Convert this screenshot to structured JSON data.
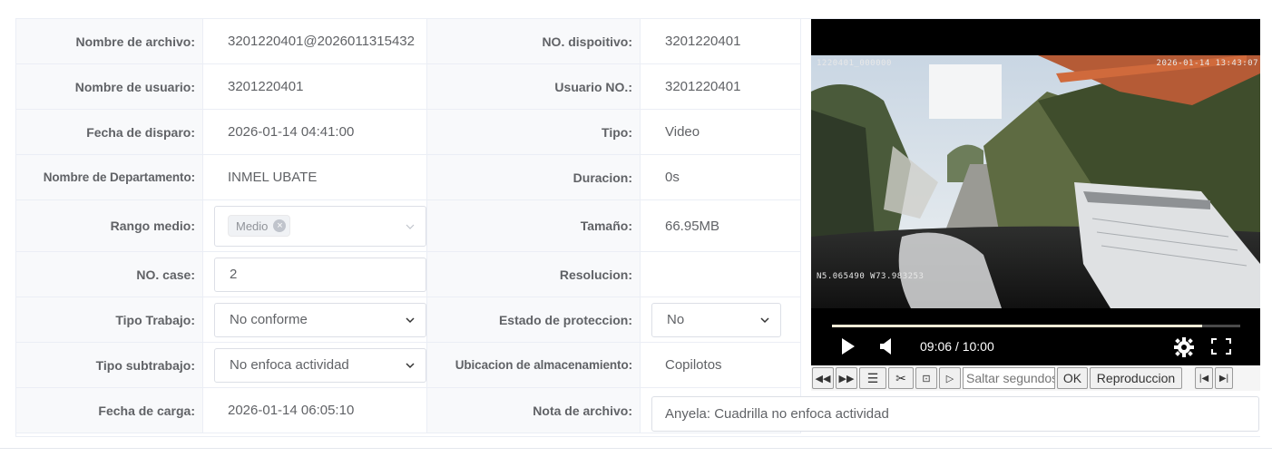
{
  "rows": [
    {
      "l1": "Nombre de archivo:",
      "v1": "3201220401@2026011315432",
      "l2": "NO. dispoitivo:",
      "v2": "3201220401"
    },
    {
      "l1": "Nombre de usuario:",
      "v1": "3201220401",
      "l2": "Usuario NO.:",
      "v2": "3201220401"
    },
    {
      "l1": "Fecha de disparo:",
      "v1": "2026-01-14 04:41:00",
      "l2": "Tipo:",
      "v2": "Video"
    },
    {
      "l1": "Nombre de Departamento:",
      "v1": "INMEL UBATE",
      "l2": "Duracion:",
      "v2": "0s"
    },
    {
      "l1": "Rango medio:",
      "v1_tag": "Medio",
      "l2": "Tamaño:",
      "v2": "66.95MB"
    },
    {
      "l1": "NO. case:",
      "v1_input": "2",
      "l2": "Resolucion:",
      "v2": ""
    },
    {
      "l1": "Tipo Trabajo:",
      "v1_select": "No conforme",
      "l2": "Estado de proteccion:",
      "v2_select": "No"
    },
    {
      "l1": "Tipo subtrabajo:",
      "v1_select": "No enfoca actividad",
      "l2": "Ubicacion de almacenamiento:",
      "v2": "Copilotos"
    },
    {
      "l1": "Fecha de carga:",
      "v1": "2026-01-14 06:05:10",
      "l2": "Nota de archivo:",
      "v2_note": "Anyela: Cuadrilla no enfoca actividad"
    }
  ],
  "player": {
    "osd_top_left": "1220401_000000",
    "osd_top_right": "2026-01-14 13:43:07",
    "osd_bottom_left": "N5.065490 W73.983253",
    "time": "09:06 / 10:00",
    "progress": 0.906
  },
  "toolbar": {
    "skip_placeholder": "Saltar segundos",
    "ok_label": "OK",
    "playback_label": "Reproduccion"
  }
}
